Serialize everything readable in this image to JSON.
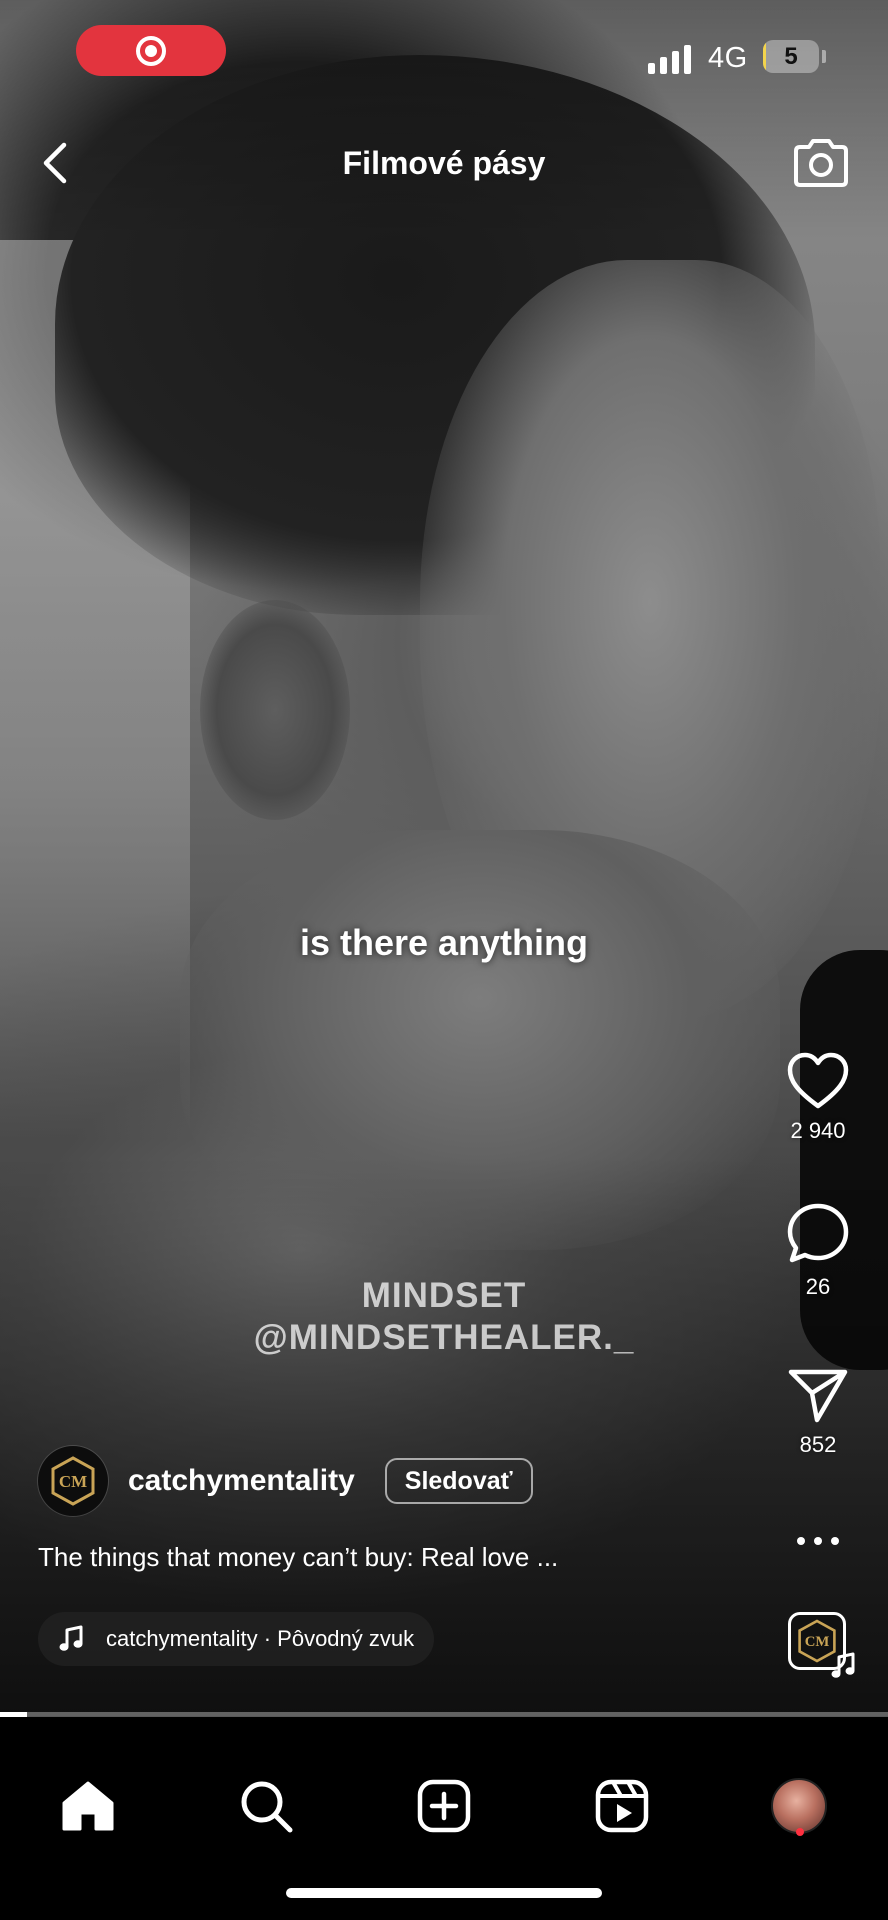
{
  "header": {
    "title": "Filmové pásy"
  },
  "status_bar": {
    "network": "4G",
    "battery": "5",
    "battery_level_percent": 5
  },
  "video": {
    "subtitle": "is there anything",
    "watermark_line1": "MINDSET",
    "watermark_line2": "@MINDSETHEALER._",
    "progress_percent": 3
  },
  "actions": {
    "likes": "2 940",
    "comments": "26",
    "shares": "852"
  },
  "post": {
    "author": "catchymentality",
    "follow_label": "Sledovať",
    "caption": "The things that money can’t buy: Real love ...",
    "audio": "catchymentality · Pôvodný zvuk",
    "avatar_logo_text": "CM"
  },
  "icons": {
    "back": "chevron-left-icon",
    "camera": "camera-icon",
    "like": "heart-icon",
    "comment": "comment-bubble-icon",
    "share": "paper-plane-icon",
    "more": "more-dots-icon",
    "music": "music-note-icon",
    "nav": [
      "home-icon",
      "search-icon",
      "create-icon",
      "reels-icon",
      "profile-avatar"
    ]
  },
  "colors": {
    "record_pill": "#e3343e",
    "battery_fill": "#f3d44c",
    "logo_gold": "#c9a456",
    "activity_dot": "#ff3040"
  }
}
